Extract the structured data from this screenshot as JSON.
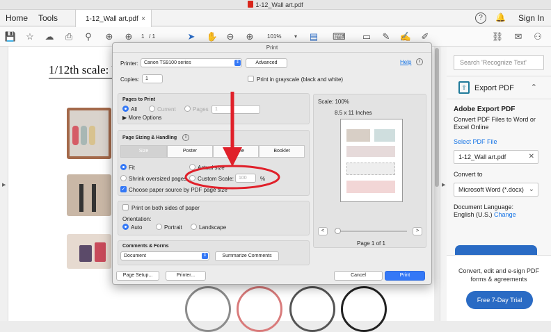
{
  "window": {
    "title": "1-12_Wall art.pdf"
  },
  "menu": {
    "home": "Home",
    "tools": "Tools",
    "sign_in": "Sign In",
    "help_icon": "?"
  },
  "tab": {
    "label": "1-12_Wall art.pdf",
    "close": "×"
  },
  "toolbar": {
    "page_current": "1",
    "page_total": "/  1",
    "zoom": "101%"
  },
  "document": {
    "heading": "1/12th scale: W"
  },
  "right_panel": {
    "search_placeholder": "Search 'Recognize Text'",
    "export_title": "Export PDF",
    "adobe_export_title": "Adobe Export PDF",
    "convert_desc": "Convert PDF Files to Word or Excel Online",
    "select_pdf": "Select PDF File",
    "selected_file": "1-12_Wall art.pdf",
    "convert_to": "Convert to",
    "format": "Microsoft Word (*.docx)",
    "doc_language_label": "Document Language:",
    "doc_language": "English (U.S.)",
    "change": "Change",
    "promo": "Convert, edit and e-sign PDF forms & agreements",
    "trial_button": "Free 7-Day Trial"
  },
  "print_dialog": {
    "title": "Print",
    "printer_label": "Printer:",
    "printer": "Canon TS9100 series",
    "advanced": "Advanced",
    "help": "Help",
    "copies_label": "Copies:",
    "copies": "1",
    "grayscale": "Print in grayscale (black and white)",
    "pages_to_print": "Pages to Print",
    "all": "All",
    "current": "Current",
    "pages": "Pages",
    "pages_value": "1",
    "more_options": "More Options",
    "sizing_title": "Page Sizing & Handling",
    "sizing_modes": [
      "Size",
      "Poster",
      "Multiple",
      "Booklet"
    ],
    "fit": "Fit",
    "actual_size": "Actual size",
    "shrink": "Shrink oversized pages",
    "custom_scale": "Custom Scale:",
    "custom_scale_value": "100",
    "percent": "%",
    "choose_source": "Choose paper source by PDF page size",
    "both_sides": "Print on both sides of paper",
    "orientation_label": "Orientation:",
    "auto": "Auto",
    "portrait": "Portrait",
    "landscape": "Landscape",
    "comments_title": "Comments & Forms",
    "comments_value": "Document",
    "summarize": "Summarize Comments",
    "page_setup": "Page Setup...",
    "printer_btn": "Printer...",
    "cancel": "Cancel",
    "print": "Print",
    "scale": "Scale: 100%",
    "paper_size": "8.5 x 11 Inches",
    "page_of": "Page 1 of 1",
    "prev": "<",
    "next": ">"
  },
  "colors": {
    "accent": "#3478f6",
    "annotation": "#e0202a",
    "adobe_blue": "#2a6bc4"
  }
}
